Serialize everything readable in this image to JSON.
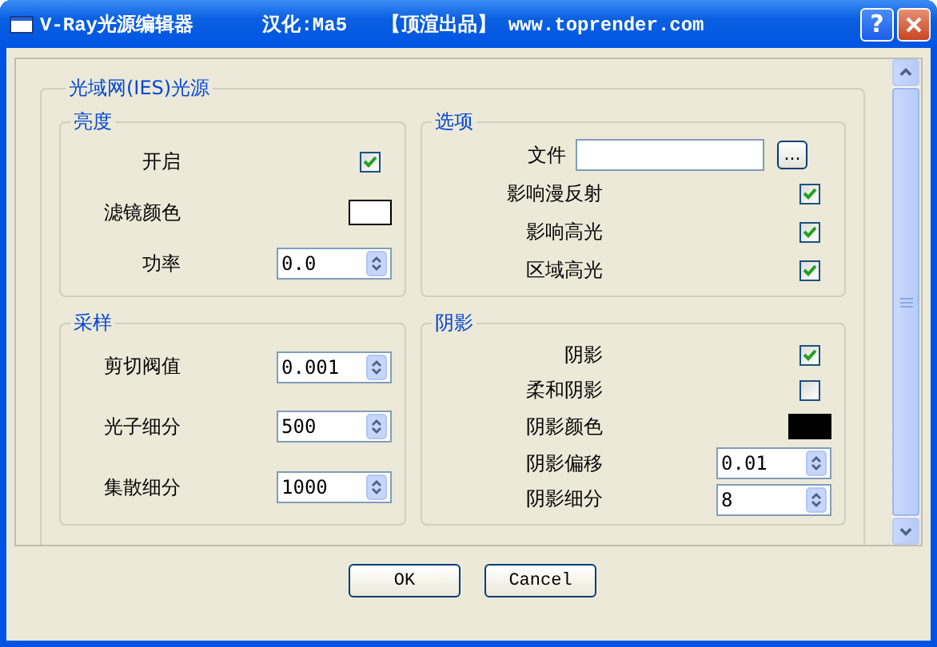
{
  "window": {
    "title": "V-Ray光源编辑器      汉化:Ma5   【顶渲出品】 www.toprender.com",
    "help_button": "?"
  },
  "panel": {
    "title": "光域网(IES)光源",
    "groups": [
      {
        "title": "亮度",
        "rows": [
          {
            "kind": "checkbox",
            "label": "开启",
            "checked": true
          },
          {
            "kind": "color",
            "label": "滤镜颜色",
            "color": "#ffffff"
          },
          {
            "kind": "spinner",
            "label": "功率",
            "value": "0.0"
          }
        ]
      },
      {
        "title": "选项",
        "rows": [
          {
            "kind": "file",
            "label": "文件",
            "button": "..."
          },
          {
            "kind": "checkbox",
            "label": "影响漫反射",
            "checked": true
          },
          {
            "kind": "checkbox",
            "label": "影响高光",
            "checked": true
          },
          {
            "kind": "checkbox",
            "label": "区域高光",
            "checked": true
          }
        ]
      },
      {
        "title": "采样",
        "rows": [
          {
            "kind": "spinner",
            "label": "剪切阀值",
            "value": "0.001"
          },
          {
            "kind": "spinner",
            "label": "光子细分",
            "value": "500"
          },
          {
            "kind": "spinner",
            "label": "集散细分",
            "value": "1000"
          }
        ]
      },
      {
        "title": "阴影",
        "rows": [
          {
            "kind": "checkbox",
            "label": "阴影",
            "checked": true
          },
          {
            "kind": "checkbox",
            "label": "柔和阴影",
            "checked": false
          },
          {
            "kind": "color",
            "label": "阴影颜色",
            "color": "#000000"
          },
          {
            "kind": "spinner",
            "label": "阴影偏移",
            "value": "0.01"
          },
          {
            "kind": "spinner",
            "label": "阴影细分",
            "value": "8"
          }
        ]
      }
    ]
  },
  "buttons": [
    "OK",
    "Cancel"
  ]
}
